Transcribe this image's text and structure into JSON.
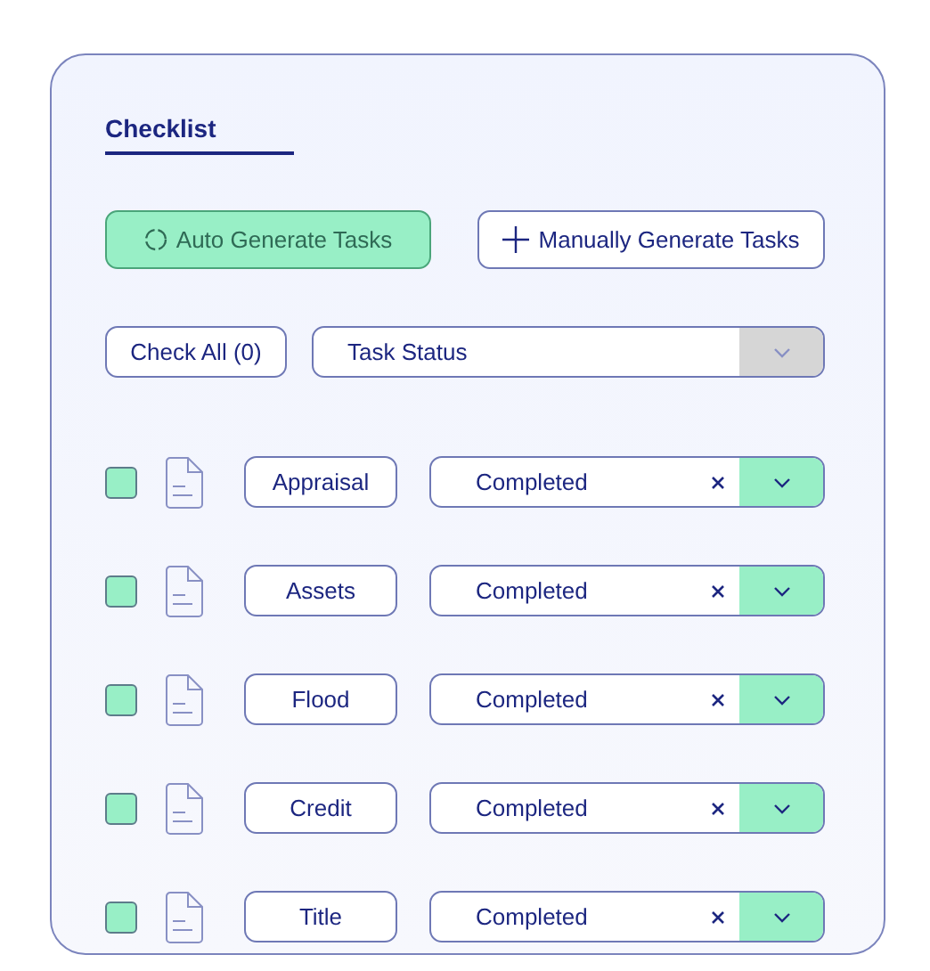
{
  "title": "Checklist",
  "actions": [
    {
      "kind": "auto",
      "label": "Auto Generate Tasks",
      "selected": true
    },
    {
      "kind": "manual",
      "label": "Manually Generate Tasks",
      "selected": false
    }
  ],
  "check_all": {
    "label": "Check All (0)"
  },
  "status_filter": {
    "value": "Task Status"
  },
  "tasks": [
    {
      "name": "Appraisal",
      "checked": true,
      "status": "Completed"
    },
    {
      "name": "Assets",
      "checked": true,
      "status": "Completed"
    },
    {
      "name": "Flood",
      "checked": true,
      "status": "Completed"
    },
    {
      "name": "Credit",
      "checked": true,
      "status": "Completed"
    },
    {
      "name": "Title",
      "checked": true,
      "status": "Completed"
    }
  ]
}
